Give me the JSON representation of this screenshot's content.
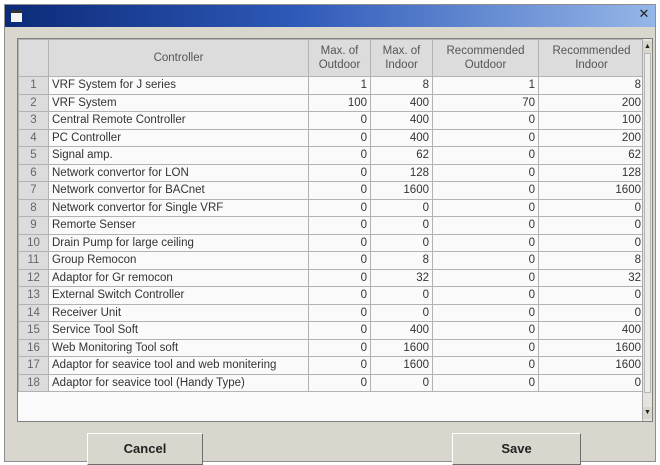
{
  "window": {
    "close_glyph": "✕"
  },
  "grid": {
    "columns": [
      "Controller",
      "Max. of Outdoor",
      "Max. of Indoor",
      "Recommended Outdoor",
      "Recommended Indoor"
    ],
    "rows": [
      {
        "n": "1",
        "name": "VRF System for J series",
        "mo": "1",
        "mi": "8",
        "ro": "1",
        "ri": "8"
      },
      {
        "n": "2",
        "name": "VRF System",
        "mo": "100",
        "mi": "400",
        "ro": "70",
        "ri": "200"
      },
      {
        "n": "3",
        "name": "Central Remote Controller",
        "mo": "0",
        "mi": "400",
        "ro": "0",
        "ri": "100"
      },
      {
        "n": "4",
        "name": "PC Controller",
        "mo": "0",
        "mi": "400",
        "ro": "0",
        "ri": "200"
      },
      {
        "n": "5",
        "name": "Signal amp.",
        "mo": "0",
        "mi": "62",
        "ro": "0",
        "ri": "62"
      },
      {
        "n": "6",
        "name": "Network convertor for LON",
        "mo": "0",
        "mi": "128",
        "ro": "0",
        "ri": "128"
      },
      {
        "n": "7",
        "name": "Network convertor for BACnet",
        "mo": "0",
        "mi": "1600",
        "ro": "0",
        "ri": "1600"
      },
      {
        "n": "8",
        "name": "Network convertor for Single VRF",
        "mo": "0",
        "mi": "0",
        "ro": "0",
        "ri": "0"
      },
      {
        "n": "9",
        "name": "Remorte Senser",
        "mo": "0",
        "mi": "0",
        "ro": "0",
        "ri": "0"
      },
      {
        "n": "10",
        "name": "Drain Pump for large ceiling",
        "mo": "0",
        "mi": "0",
        "ro": "0",
        "ri": "0"
      },
      {
        "n": "11",
        "name": "Group Remocon",
        "mo": "0",
        "mi": "8",
        "ro": "0",
        "ri": "8"
      },
      {
        "n": "12",
        "name": "Adaptor for Gr remocon",
        "mo": "0",
        "mi": "32",
        "ro": "0",
        "ri": "32"
      },
      {
        "n": "13",
        "name": "External Switch Controller",
        "mo": "0",
        "mi": "0",
        "ro": "0",
        "ri": "0"
      },
      {
        "n": "14",
        "name": "Receiver Unit",
        "mo": "0",
        "mi": "0",
        "ro": "0",
        "ri": "0"
      },
      {
        "n": "15",
        "name": "Service Tool Soft",
        "mo": "0",
        "mi": "400",
        "ro": "0",
        "ri": "400"
      },
      {
        "n": "16",
        "name": "Web Monitoring Tool soft",
        "mo": "0",
        "mi": "1600",
        "ro": "0",
        "ri": "1600"
      },
      {
        "n": "17",
        "name": "Adaptor for seavice tool and web monitering",
        "mo": "0",
        "mi": "1600",
        "ro": "0",
        "ri": "1600"
      },
      {
        "n": "18",
        "name": "Adaptor for seavice tool (Handy Type)",
        "mo": "0",
        "mi": "0",
        "ro": "0",
        "ri": "0"
      }
    ]
  },
  "scrollbar": {
    "up_glyph": "▲",
    "down_glyph": "▼"
  },
  "buttons": {
    "cancel": "Cancel",
    "save": "Save"
  }
}
